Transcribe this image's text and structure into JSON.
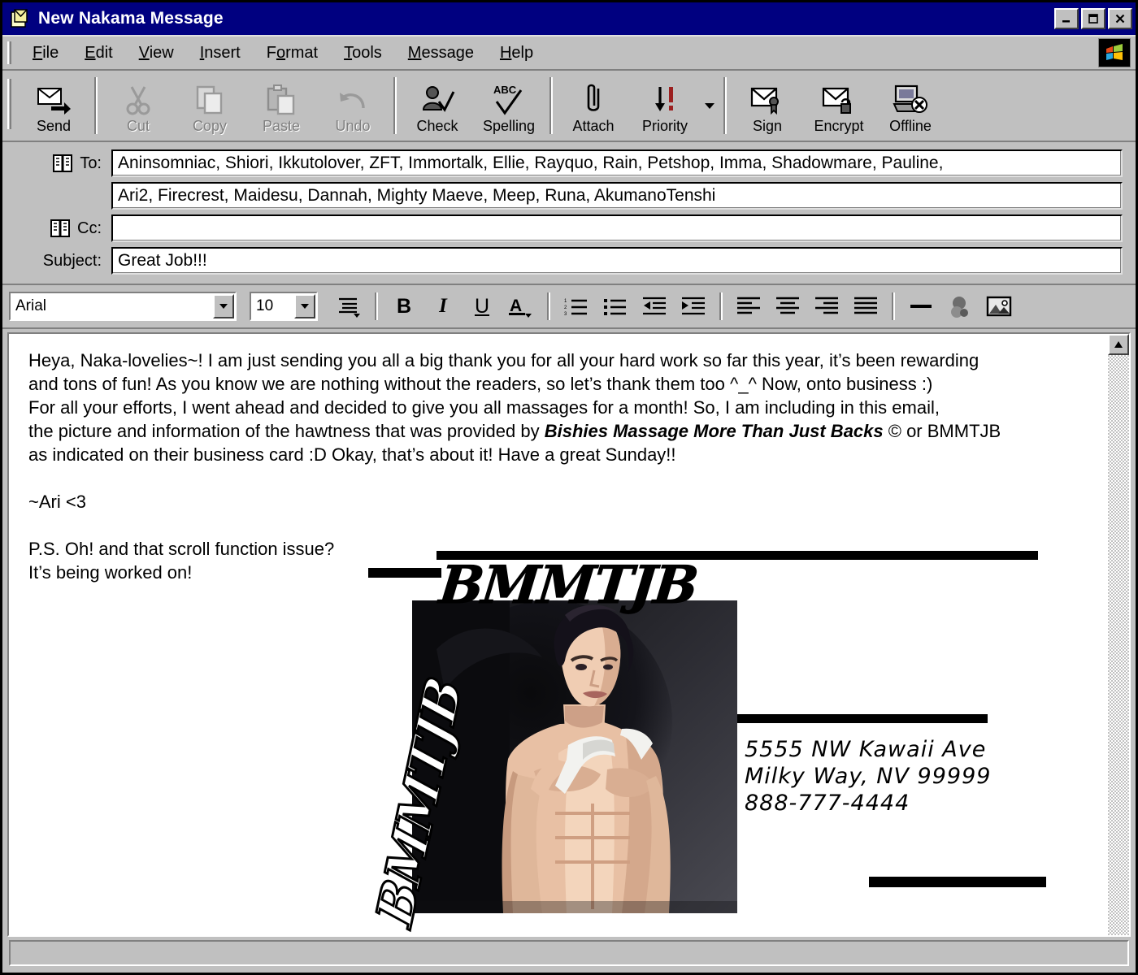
{
  "window": {
    "title": "New Nakama Message",
    "icon": "message-window-icon",
    "controls": [
      {
        "name": "minimize-button",
        "glyph": "_"
      },
      {
        "name": "maximize-button",
        "glyph": "□"
      },
      {
        "name": "close-button",
        "glyph": "✕"
      }
    ]
  },
  "menubar": {
    "items": [
      {
        "label": "File",
        "accel": "F"
      },
      {
        "label": "Edit",
        "accel": "E"
      },
      {
        "label": "View",
        "accel": "V"
      },
      {
        "label": "Insert",
        "accel": "I"
      },
      {
        "label": "Format",
        "accel": "o"
      },
      {
        "label": "Tools",
        "accel": "T"
      },
      {
        "label": "Message",
        "accel": "M"
      },
      {
        "label": "Help",
        "accel": "H"
      }
    ],
    "logo": "windows-flag-logo"
  },
  "toolbar": {
    "buttons": [
      {
        "label": "Send",
        "icon": "send-icon",
        "enabled": true
      },
      {
        "label": "Cut",
        "icon": "cut-icon",
        "enabled": false
      },
      {
        "label": "Copy",
        "icon": "copy-icon",
        "enabled": false
      },
      {
        "label": "Paste",
        "icon": "paste-icon",
        "enabled": false
      },
      {
        "label": "Undo",
        "icon": "undo-icon",
        "enabled": false
      },
      {
        "label": "Check",
        "icon": "check-names-icon",
        "enabled": true
      },
      {
        "label": "Spelling",
        "icon": "spelling-icon",
        "enabled": true
      },
      {
        "label": "Attach",
        "icon": "paperclip-icon",
        "enabled": true
      },
      {
        "label": "Priority",
        "icon": "priority-icon",
        "enabled": true
      },
      {
        "label": "Sign",
        "icon": "sign-icon",
        "enabled": true
      },
      {
        "label": "Encrypt",
        "icon": "encrypt-icon",
        "enabled": true
      },
      {
        "label": "Offline",
        "icon": "offline-icon",
        "enabled": true
      }
    ]
  },
  "headers": {
    "to_label": "To:",
    "to_line1": "Aninsomniac, Shiori, Ikkutolover, ZFT, Immortalk, Ellie, Rayquo, Rain, Petshop, Imma, Shadowmare, Pauline,",
    "to_line2": "Ari2, Firecrest, Maidesu, Dannah, Mighty Maeve, Meep, Runa, AkumanoTenshi",
    "cc_label": "Cc:",
    "cc_value": "",
    "subject_label": "Subject:",
    "subject_value": "Great Job!!!"
  },
  "format_toolbar": {
    "font_family": "Arial",
    "font_size": "10",
    "buttons": [
      {
        "name": "paragraph-style-button",
        "glyph": "≡"
      },
      {
        "name": "bold-button",
        "glyph": "B"
      },
      {
        "name": "italic-button",
        "glyph": "I"
      },
      {
        "name": "underline-button",
        "glyph": "U"
      },
      {
        "name": "font-color-button",
        "glyph": "A"
      },
      {
        "name": "numbered-list-button",
        "glyph": "≣"
      },
      {
        "name": "bulleted-list-button",
        "glyph": "≣"
      },
      {
        "name": "decrease-indent-button",
        "glyph": "←"
      },
      {
        "name": "increase-indent-button",
        "glyph": "→"
      },
      {
        "name": "align-left-button",
        "glyph": "≡"
      },
      {
        "name": "align-center-button",
        "glyph": "≡"
      },
      {
        "name": "align-right-button",
        "glyph": "≡"
      },
      {
        "name": "justify-button",
        "glyph": "≡"
      },
      {
        "name": "horizontal-line-button",
        "glyph": "—"
      },
      {
        "name": "insert-link-button",
        "glyph": "●"
      },
      {
        "name": "insert-picture-button",
        "glyph": "▣"
      }
    ]
  },
  "message": {
    "paragraphs": [
      {
        "type": "text",
        "text": "Heya, Naka-lovelies~! I am just sending you all a big thank you for all your hard work so far this year, it’s been rewarding"
      },
      {
        "type": "text",
        "text": "and tons of fun! As you know we are nothing without the readers, so let’s thank them too ^_^ Now, onto business :)"
      },
      {
        "type": "text",
        "text": "For all your efforts, I went ahead and decided to give you all massages for a month! So, I am including in this email,"
      },
      {
        "type": "rich",
        "pre": "the picture and information of the hawtness that was provided by ",
        "emphasis": "Bishies Massage More Than Just Backs",
        "post": " © or BMMTJB"
      },
      {
        "type": "text",
        "text": "as indicated on their business card :D Okay, that’s about it! Have a great Sunday!!"
      },
      {
        "type": "blank"
      },
      {
        "type": "text",
        "text": "~Ari <3"
      },
      {
        "type": "blank"
      },
      {
        "type": "text",
        "text": "P.S. Oh! and that scroll function issue?"
      },
      {
        "type": "text",
        "text": "It’s being worked on!"
      }
    ]
  },
  "business_card": {
    "logo_text": "BMMTJB",
    "logo_text_rotated": "BMMTJB",
    "photo_alt": "shirtless-male-model-photo",
    "address_lines": [
      "5555 NW Kawaii Ave",
      "Milky Way, NV 99999",
      "888-777-4444"
    ]
  },
  "scrollbar": {
    "up_arrow": "▲",
    "down_arrow": "▼"
  },
  "statusbar": {
    "text": ""
  },
  "colors": {
    "titlebar": "#000080",
    "face": "#c0c0c0",
    "shadow": "#808080",
    "highlight": "#ffffff",
    "text": "#000000",
    "disabled_text": "#808080",
    "field_bg": "#ffffff"
  }
}
